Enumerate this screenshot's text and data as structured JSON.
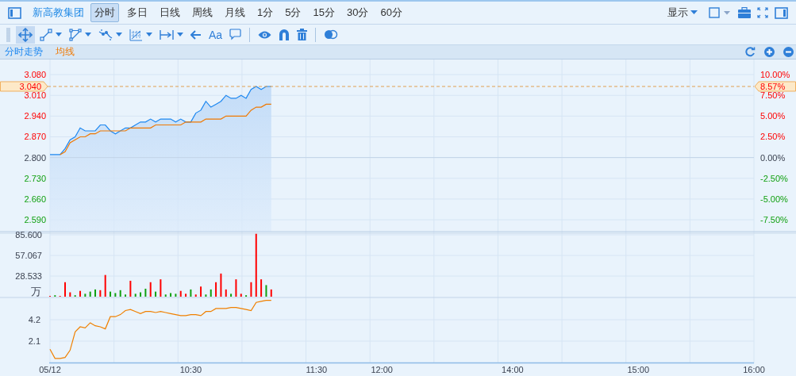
{
  "toolbar": {
    "stock_name": "新高教集团",
    "periods": [
      {
        "label": "分时",
        "selected": true
      },
      {
        "label": "多日",
        "selected": false
      },
      {
        "label": "日线",
        "selected": false
      },
      {
        "label": "周线",
        "selected": false
      },
      {
        "label": "月线",
        "selected": false
      },
      {
        "label": "1分",
        "selected": false
      },
      {
        "label": "5分",
        "selected": false
      },
      {
        "label": "15分",
        "selected": false
      },
      {
        "label": "30分",
        "selected": false
      },
      {
        "label": "60分",
        "selected": false
      }
    ],
    "display_menu": "显示"
  },
  "tool_groups": [
    [
      {
        "kind": "move",
        "selected": true,
        "dropdown": false
      },
      {
        "kind": "segment",
        "selected": false,
        "dropdown": true
      },
      {
        "kind": "polyline",
        "selected": false,
        "dropdown": true
      },
      {
        "kind": "wave",
        "selected": false,
        "dropdown": true
      },
      {
        "kind": "grid",
        "selected": false,
        "dropdown": true
      },
      {
        "kind": "measure",
        "selected": false,
        "dropdown": true
      },
      {
        "kind": "arrow",
        "selected": false,
        "dropdown": false
      },
      {
        "kind": "text",
        "label": "Aa",
        "selected": false,
        "dropdown": false
      },
      {
        "kind": "comment",
        "selected": false,
        "dropdown": false
      }
    ],
    [
      {
        "kind": "eye",
        "selected": false,
        "dropdown": false
      },
      {
        "kind": "magnet",
        "selected": false,
        "dropdown": false
      },
      {
        "kind": "trash",
        "selected": false,
        "dropdown": false
      }
    ],
    [
      {
        "kind": "overlap",
        "selected": false,
        "dropdown": false
      }
    ]
  ],
  "price_panel": {
    "current_change": "8.57%",
    "right_ticks": [
      "10.00%",
      "7.50%",
      "5.00%",
      "2.50%",
      "0.00%",
      "-2.50%",
      "-5.00%",
      "-7.50%"
    ],
    "chart_data": {
      "type": "line",
      "grid": true,
      "ylim": [
        2.55,
        3.131
      ],
      "yticks": [
        {
          "value": 2.59,
          "label": "2.590"
        },
        {
          "value": 2.66,
          "label": "2.660"
        },
        {
          "value": 2.73,
          "label": "2.730"
        },
        {
          "value": 2.8,
          "label": "2.800"
        },
        {
          "value": 2.87,
          "label": "2.870"
        },
        {
          "value": 2.94,
          "label": "2.940"
        },
        {
          "value": 3.01,
          "label": "3.010"
        },
        {
          "value": 3.08,
          "label": "3.080"
        }
      ],
      "categories": [
        null,
        null,
        null,
        null,
        null,
        null,
        null,
        null,
        null,
        null,
        null,
        null,
        null,
        null,
        null,
        null,
        null,
        null,
        null,
        null,
        null,
        null,
        null,
        null,
        null,
        null,
        null,
        null,
        null,
        null,
        null,
        null,
        null,
        null,
        null,
        null,
        null,
        null,
        null,
        null,
        null,
        null,
        null,
        null,
        null,
        null,
        null,
        null,
        null,
        null,
        null,
        null,
        null,
        null,
        null,
        null,
        null,
        null,
        null,
        null,
        null,
        null,
        null,
        null,
        null,
        null,
        null,
        null,
        null,
        null,
        null,
        null,
        null,
        null,
        null,
        null,
        null,
        null,
        null,
        null,
        null,
        null,
        null,
        null,
        null,
        null,
        null,
        null,
        null,
        null,
        null,
        null,
        null,
        null,
        null,
        null,
        null,
        null,
        null,
        null,
        null,
        null,
        null,
        null,
        null,
        null,
        null,
        null,
        null,
        null,
        null,
        null,
        null,
        null,
        null,
        null,
        null,
        null,
        null,
        null,
        null,
        null,
        null,
        null,
        null,
        null,
        null,
        null,
        null,
        null,
        null,
        null,
        null,
        null,
        null,
        null,
        null,
        null,
        null,
        null,
        null
      ],
      "series": [
        {
          "name": "分时走势",
          "color": "#1e88f0",
          "values": [
            2.81,
            2.81,
            2.81,
            2.83,
            2.86,
            2.87,
            2.9,
            2.89,
            2.89,
            2.89,
            2.91,
            2.91,
            2.89,
            2.88,
            2.89,
            2.9,
            2.9,
            2.91,
            2.92,
            2.92,
            2.93,
            2.92,
            2.93,
            2.93,
            2.93,
            2.92,
            2.93,
            2.92,
            2.92,
            2.95,
            2.96,
            2.99,
            2.97,
            2.98,
            2.99,
            3.01,
            3.0,
            3.0,
            3.01,
            3.0,
            3.03,
            3.04,
            3.03,
            3.04,
            3.04,
            null,
            null,
            null,
            null,
            null,
            null,
            null,
            null,
            null,
            null,
            null,
            null,
            null,
            null,
            null,
            null,
            null,
            null,
            null,
            null,
            null,
            null,
            null,
            null,
            null,
            null,
            null,
            null,
            null,
            null,
            null,
            null,
            null,
            null,
            null,
            null,
            null,
            null,
            null,
            null,
            null,
            null,
            null,
            null,
            null,
            null,
            null,
            null,
            null,
            null,
            null,
            null,
            null,
            null,
            null,
            null,
            null,
            null,
            null,
            null,
            null,
            null,
            null,
            null,
            null,
            null,
            null,
            null,
            null,
            null,
            null,
            null,
            null,
            null,
            null,
            null,
            null,
            null,
            null,
            null,
            null,
            null,
            null,
            null,
            null,
            null,
            null,
            null,
            null,
            null,
            null,
            null,
            null,
            null,
            null,
            null
          ]
        },
        {
          "name": "均线",
          "color": "#f07800",
          "values": [
            null,
            null,
            2.81,
            2.82,
            2.85,
            2.86,
            2.87,
            2.87,
            2.88,
            2.88,
            2.89,
            2.89,
            2.89,
            2.89,
            2.89,
            2.89,
            2.9,
            2.9,
            2.9,
            2.9,
            2.9,
            2.91,
            2.91,
            2.91,
            2.91,
            2.91,
            2.91,
            2.92,
            2.92,
            2.92,
            2.92,
            2.93,
            2.93,
            2.93,
            2.93,
            2.94,
            2.94,
            2.94,
            2.94,
            2.94,
            2.96,
            2.97,
            2.97,
            2.98,
            2.98,
            null,
            null,
            null,
            null,
            null,
            null,
            null,
            null,
            null,
            null,
            null,
            null,
            null,
            null,
            null,
            null,
            null,
            null,
            null,
            null,
            null,
            null,
            null,
            null,
            null,
            null,
            null,
            null,
            null,
            null,
            null,
            null,
            null,
            null,
            null,
            null,
            null,
            null,
            null,
            null,
            null,
            null,
            null,
            null,
            null,
            null,
            null,
            null,
            null,
            null,
            null,
            null,
            null,
            null,
            null,
            null,
            null,
            null,
            null,
            null,
            null,
            null,
            null,
            null,
            null,
            null,
            null,
            null,
            null,
            null,
            null,
            null,
            null,
            null,
            null,
            null,
            null,
            null,
            null,
            null,
            null,
            null,
            null,
            null,
            null,
            null,
            null,
            null,
            null,
            null,
            null,
            null,
            null,
            null,
            null,
            null
          ]
        }
      ],
      "ref_lines": [
        {
          "axis": "y",
          "value": 2.8
        },
        {
          "axis": "y",
          "value": 3.04,
          "label": "3.040"
        }
      ]
    }
  },
  "volume_panel": {
    "unit": "万",
    "chart_data": {
      "type": "bar",
      "grid": true,
      "ylim": [
        0,
        87.8
      ],
      "yticks": [
        {
          "value": 28.533,
          "label": "28.533"
        },
        {
          "value": 57.067,
          "label": "57.067"
        },
        {
          "value": 85.6,
          "label": "85.600"
        }
      ],
      "categories": [
        null,
        null,
        null,
        null,
        null,
        null,
        null,
        null,
        null,
        null,
        null,
        null,
        null,
        null,
        null,
        null,
        null,
        null,
        null,
        null,
        null,
        null,
        null,
        null,
        null,
        null,
        null,
        null,
        null,
        null,
        null,
        null,
        null,
        null,
        null,
        null,
        null,
        null,
        null,
        null,
        null,
        null,
        null,
        null,
        null,
        null,
        null,
        null,
        null,
        null,
        null,
        null,
        null,
        null,
        null,
        null,
        null,
        null,
        null,
        null,
        null,
        null,
        null,
        null,
        null,
        null,
        null,
        null,
        null,
        null,
        null,
        null,
        null,
        null,
        null,
        null,
        null,
        null,
        null,
        null,
        null,
        null,
        null,
        null,
        null,
        null,
        null,
        null,
        null,
        null,
        null,
        null,
        null,
        null,
        null,
        null,
        null,
        null,
        null,
        null,
        null,
        null,
        null,
        null,
        null,
        null,
        null,
        null,
        null,
        null,
        null,
        null,
        null,
        null,
        null,
        null,
        null,
        null,
        null,
        null,
        null,
        null,
        null,
        null,
        null,
        null,
        null,
        null,
        null,
        null,
        null,
        null,
        null,
        null,
        null,
        null,
        null,
        null,
        null,
        null,
        null
      ],
      "series": [
        {
          "color": "#ff0000",
          "values": [
            1,
            null,
            1,
            20,
            6,
            null,
            8,
            null,
            null,
            null,
            9,
            30,
            null,
            null,
            null,
            null,
            22,
            null,
            null,
            null,
            20,
            null,
            24,
            null,
            null,
            null,
            8,
            4,
            null,
            3,
            14,
            null,
            null,
            20,
            32,
            10,
            null,
            24,
            4,
            null,
            20,
            87,
            24,
            null,
            10,
            null,
            null,
            null,
            null,
            null,
            null,
            null,
            null,
            null,
            null,
            null,
            null,
            null,
            null,
            null,
            null,
            null,
            null,
            null,
            null,
            null,
            null,
            null,
            null,
            null,
            null,
            null,
            null,
            null,
            null,
            null,
            null,
            null,
            null,
            null,
            null,
            null,
            null,
            null,
            null,
            null,
            null,
            null,
            null,
            null,
            null,
            null,
            null,
            null,
            null,
            null,
            null,
            null,
            null,
            null,
            null,
            null,
            null,
            null,
            null,
            null,
            null,
            null,
            null,
            null,
            null,
            null,
            null,
            null,
            null,
            null,
            null,
            null,
            null,
            null,
            null,
            null,
            null,
            null,
            null,
            null,
            null,
            null,
            null,
            null,
            null,
            null,
            null,
            null,
            null,
            null,
            null,
            null,
            null,
            null,
            null
          ]
        },
        {
          "color": "#10a010",
          "values": [
            null,
            2,
            null,
            null,
            null,
            2,
            null,
            4,
            7,
            10,
            null,
            null,
            7,
            5,
            9,
            3,
            null,
            4,
            6,
            11,
            null,
            7,
            null,
            3,
            5,
            4,
            null,
            null,
            10,
            null,
            null,
            3,
            10,
            null,
            null,
            null,
            4,
            null,
            null,
            2,
            null,
            null,
            null,
            16,
            null,
            null,
            null,
            null,
            null,
            null,
            null,
            null,
            null,
            null,
            null,
            null,
            null,
            null,
            null,
            null,
            null,
            null,
            null,
            null,
            null,
            null,
            null,
            null,
            null,
            null,
            null,
            null,
            null,
            null,
            null,
            null,
            null,
            null,
            null,
            null,
            null,
            null,
            null,
            null,
            null,
            null,
            null,
            null,
            null,
            null,
            null,
            null,
            null,
            null,
            null,
            null,
            null,
            null,
            null,
            null,
            null,
            null,
            null,
            null,
            null,
            null,
            null,
            null,
            null,
            null,
            null,
            null,
            null,
            null,
            null,
            null,
            null,
            null,
            null,
            null,
            null,
            null,
            null,
            null,
            null,
            null,
            null,
            null,
            null,
            null,
            null,
            null,
            null,
            null,
            null,
            null,
            null,
            null,
            null,
            null,
            null
          ]
        }
      ]
    }
  },
  "indicator_panel": {
    "chart_data": {
      "type": "line",
      "grid": true,
      "ylim": [
        0,
        6.38
      ],
      "yticks": [
        {
          "value": 2.1,
          "label": "2.1"
        },
        {
          "value": 4.2,
          "label": "4.2"
        }
      ],
      "categories": [
        "05/12",
        null,
        null,
        null,
        null,
        null,
        null,
        null,
        null,
        null,
        null,
        null,
        null,
        null,
        null,
        null,
        null,
        null,
        null,
        null,
        null,
        null,
        null,
        null,
        null,
        null,
        null,
        null,
        "10:30",
        null,
        null,
        null,
        null,
        null,
        null,
        null,
        null,
        null,
        null,
        null,
        null,
        null,
        null,
        null,
        null,
        null,
        null,
        null,
        null,
        null,
        null,
        null,
        null,
        "11:30",
        null,
        null,
        null,
        null,
        null,
        null,
        null,
        null,
        null,
        null,
        null,
        null,
        "12:00",
        null,
        null,
        null,
        null,
        null,
        null,
        null,
        null,
        null,
        null,
        null,
        null,
        null,
        null,
        null,
        null,
        null,
        null,
        null,
        null,
        null,
        null,
        null,
        null,
        null,
        "14:00",
        null,
        null,
        null,
        null,
        null,
        null,
        null,
        null,
        null,
        null,
        null,
        null,
        null,
        null,
        null,
        null,
        null,
        null,
        null,
        null,
        null,
        null,
        null,
        null,
        "15:00",
        null,
        null,
        null,
        null,
        null,
        null,
        null,
        null,
        null,
        null,
        null,
        null,
        null,
        null,
        null,
        null,
        null,
        null,
        null,
        null,
        null,
        null,
        "16:00"
      ],
      "series": [
        {
          "color": "#f08000",
          "values": [
            1.3,
            0.4,
            0.4,
            0.5,
            1.2,
            3.0,
            3.5,
            3.4,
            3.9,
            3.6,
            3.5,
            3.3,
            4.5,
            4.5,
            4.7,
            5.1,
            5.2,
            5.0,
            4.8,
            5.0,
            5.0,
            4.9,
            5.0,
            4.9,
            4.8,
            4.7,
            4.6,
            4.6,
            4.7,
            4.7,
            4.6,
            5.0,
            5.0,
            5.3,
            5.3,
            5.3,
            5.4,
            5.4,
            5.3,
            5.2,
            5.1,
            5.9,
            6.0,
            6.1,
            6.1,
            null,
            null,
            null,
            null,
            null,
            null,
            null,
            null,
            null,
            null,
            null,
            null,
            null,
            null,
            null,
            null,
            null,
            null,
            null,
            null,
            null,
            null,
            null,
            null,
            null,
            null,
            null,
            null,
            null,
            null,
            null,
            null,
            null,
            null,
            null,
            null,
            null,
            null,
            null,
            null,
            null,
            null,
            null,
            null,
            null,
            null,
            null,
            null,
            null,
            null,
            null,
            null,
            null,
            null,
            null,
            null,
            null,
            null,
            null,
            null,
            null,
            null,
            null,
            null,
            null,
            null,
            null,
            null,
            null,
            null,
            null,
            null,
            null,
            null,
            null,
            null,
            null,
            null,
            null,
            null,
            null,
            null,
            null,
            null,
            null,
            null,
            null,
            null,
            null,
            null,
            null,
            null,
            null,
            null,
            null,
            null
          ]
        }
      ]
    }
  }
}
